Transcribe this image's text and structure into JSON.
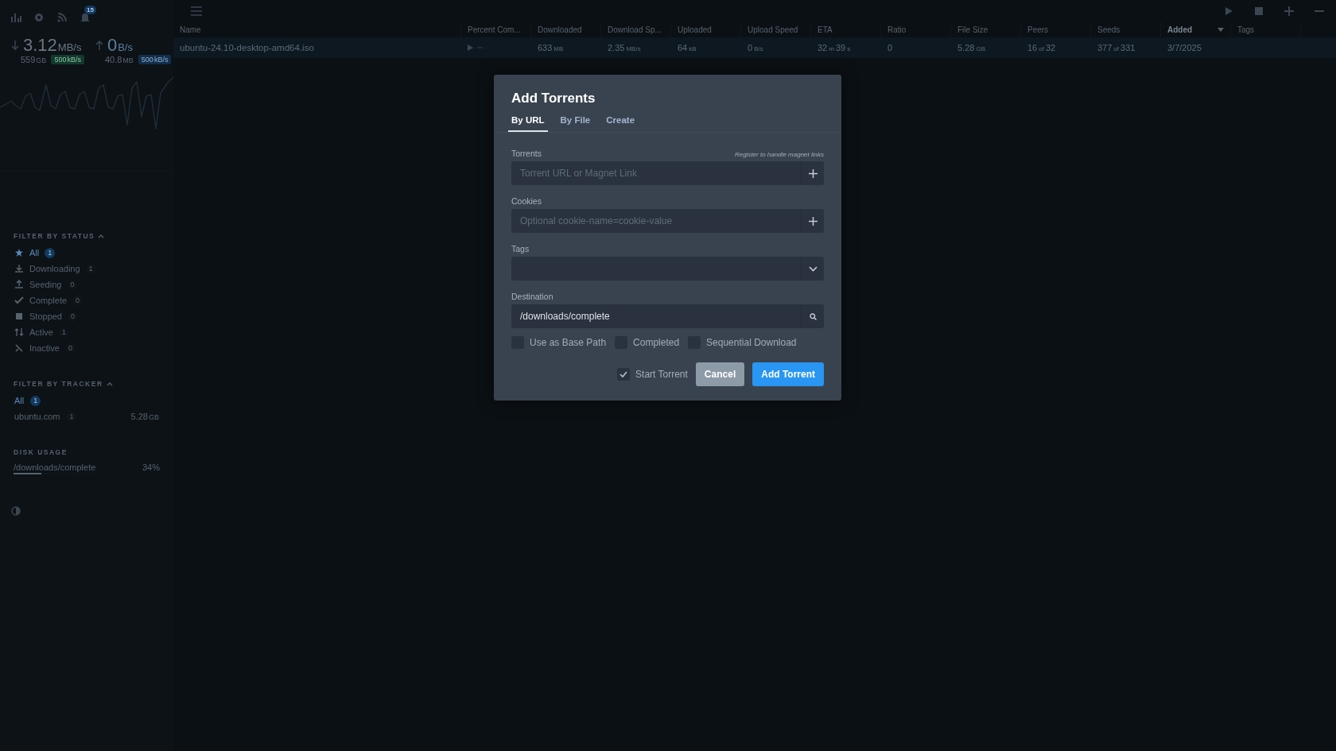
{
  "sidebar": {
    "notification_count": "15",
    "download": {
      "speed": "3.12",
      "speed_unit": "MB/s",
      "total": "559",
      "total_unit": "GB",
      "limit": "500",
      "limit_unit": "kB/s"
    },
    "upload": {
      "speed": "0",
      "speed_unit": "B/s",
      "total": "40.8",
      "total_unit": "MB",
      "limit": "500",
      "limit_unit": "kB/s"
    },
    "status_filter": {
      "title": "FILTER BY STATUS",
      "items": [
        {
          "kind": "all",
          "label": "All",
          "count": "1",
          "selected": true
        },
        {
          "kind": "downloading",
          "label": "Downloading",
          "count": "1",
          "selected": false
        },
        {
          "kind": "seeding",
          "label": "Seeding",
          "count": "0",
          "selected": false
        },
        {
          "kind": "complete",
          "label": "Complete",
          "count": "0",
          "selected": false
        },
        {
          "kind": "stopped",
          "label": "Stopped",
          "count": "0",
          "selected": false
        },
        {
          "kind": "active",
          "label": "Active",
          "count": "1",
          "selected": false
        },
        {
          "kind": "inactive",
          "label": "Inactive",
          "count": "0",
          "selected": false
        }
      ]
    },
    "tracker_filter": {
      "title": "FILTER BY TRACKER",
      "items": [
        {
          "label": "All",
          "count": "1",
          "selected": true
        },
        {
          "label": "ubuntu.com",
          "count": "1",
          "size": "5.28",
          "size_unit": "GB",
          "selected": false
        }
      ]
    },
    "disk_usage": {
      "title": "DISK USAGE",
      "items": [
        {
          "path": "/downloads/complete",
          "percent": "34%",
          "level": 0.34
        }
      ]
    }
  },
  "table": {
    "columns": [
      {
        "label": "Name",
        "sorted": false
      },
      {
        "label": "Percent Com...",
        "sorted": false
      },
      {
        "label": "Downloaded",
        "sorted": false
      },
      {
        "label": "Download Sp...",
        "sorted": false
      },
      {
        "label": "Uploaded",
        "sorted": false
      },
      {
        "label": "Upload Speed",
        "sorted": false
      },
      {
        "label": "ETA",
        "sorted": false
      },
      {
        "label": "Ratio",
        "sorted": false
      },
      {
        "label": "File Size",
        "sorted": false
      },
      {
        "label": "Peers",
        "sorted": false
      },
      {
        "label": "Seeds",
        "sorted": false
      },
      {
        "label": "Added",
        "sorted": true
      },
      {
        "label": "Tags",
        "sorted": false
      }
    ],
    "rows": [
      {
        "selected": true,
        "cells": [
          {
            "kind": "text",
            "value": "ubuntu-24.10-desktop-amd64.iso"
          },
          {
            "kind": "progress",
            "level": 0.12
          },
          {
            "kind": "text",
            "value": "633",
            "unit": "MB"
          },
          {
            "kind": "text",
            "value": "2.35",
            "unit": "MB/s"
          },
          {
            "kind": "text",
            "value": "64",
            "unit": "kB"
          },
          {
            "kind": "text",
            "value": "0",
            "unit": "B/s"
          },
          {
            "kind": "text",
            "value": "32",
            "unit": "m",
            "value2": "39",
            "unit2": "s"
          },
          {
            "kind": "text",
            "value": "0"
          },
          {
            "kind": "text",
            "value": "5.28",
            "unit": "GB"
          },
          {
            "kind": "text",
            "value": "16",
            "unit": "of",
            "value2": "32"
          },
          {
            "kind": "text",
            "value": "377",
            "unit": "of",
            "value2": "331"
          },
          {
            "kind": "text",
            "value": "3/7/2025"
          },
          {
            "kind": "text"
          }
        ]
      }
    ]
  },
  "dialog": {
    "title": "Add Torrents",
    "tabs": [
      {
        "label": "By URL",
        "selected": true
      },
      {
        "label": "By File",
        "selected": false
      },
      {
        "label": "Create",
        "selected": false
      }
    ],
    "fields": [
      {
        "kind": "add",
        "label": "Torrents",
        "hint": "Register to handle magnet links",
        "placeholder": "Torrent URL or Magnet Link"
      },
      {
        "kind": "add",
        "label": "Cookies",
        "placeholder": "Optional cookie-name=cookie-value"
      },
      {
        "kind": "select",
        "label": "Tags"
      },
      {
        "kind": "browse",
        "label": "Destination",
        "value": "/downloads/complete"
      }
    ],
    "options": [
      {
        "label": "Use as Base Path",
        "checked": false
      },
      {
        "label": "Completed",
        "checked": false
      },
      {
        "label": "Sequential Download",
        "checked": false
      }
    ],
    "start_torrent": {
      "label": "Start Torrent",
      "checked": true
    },
    "buttons": [
      {
        "kind": "secondary",
        "label": "Cancel"
      },
      {
        "kind": "primary",
        "label": "Add Torrent"
      }
    ]
  }
}
